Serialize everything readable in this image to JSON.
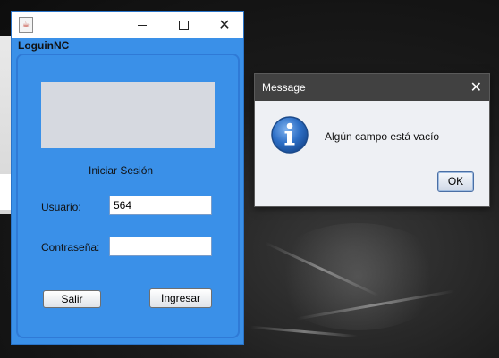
{
  "login_window": {
    "title": "",
    "menu_label": "LoguinNC",
    "heading": "Iniciar Sesión",
    "usuario_label": "Usuario:",
    "usuario_value": "564",
    "password_label": "Contraseña:",
    "password_value": "",
    "salir_button": "Salir",
    "ingresar_button": "Ingresar",
    "accent_color": "#3a90e8"
  },
  "message_dialog": {
    "title": "Message",
    "text": "Algún campo está vacío",
    "ok_button": "OK",
    "icon": "info-icon"
  }
}
